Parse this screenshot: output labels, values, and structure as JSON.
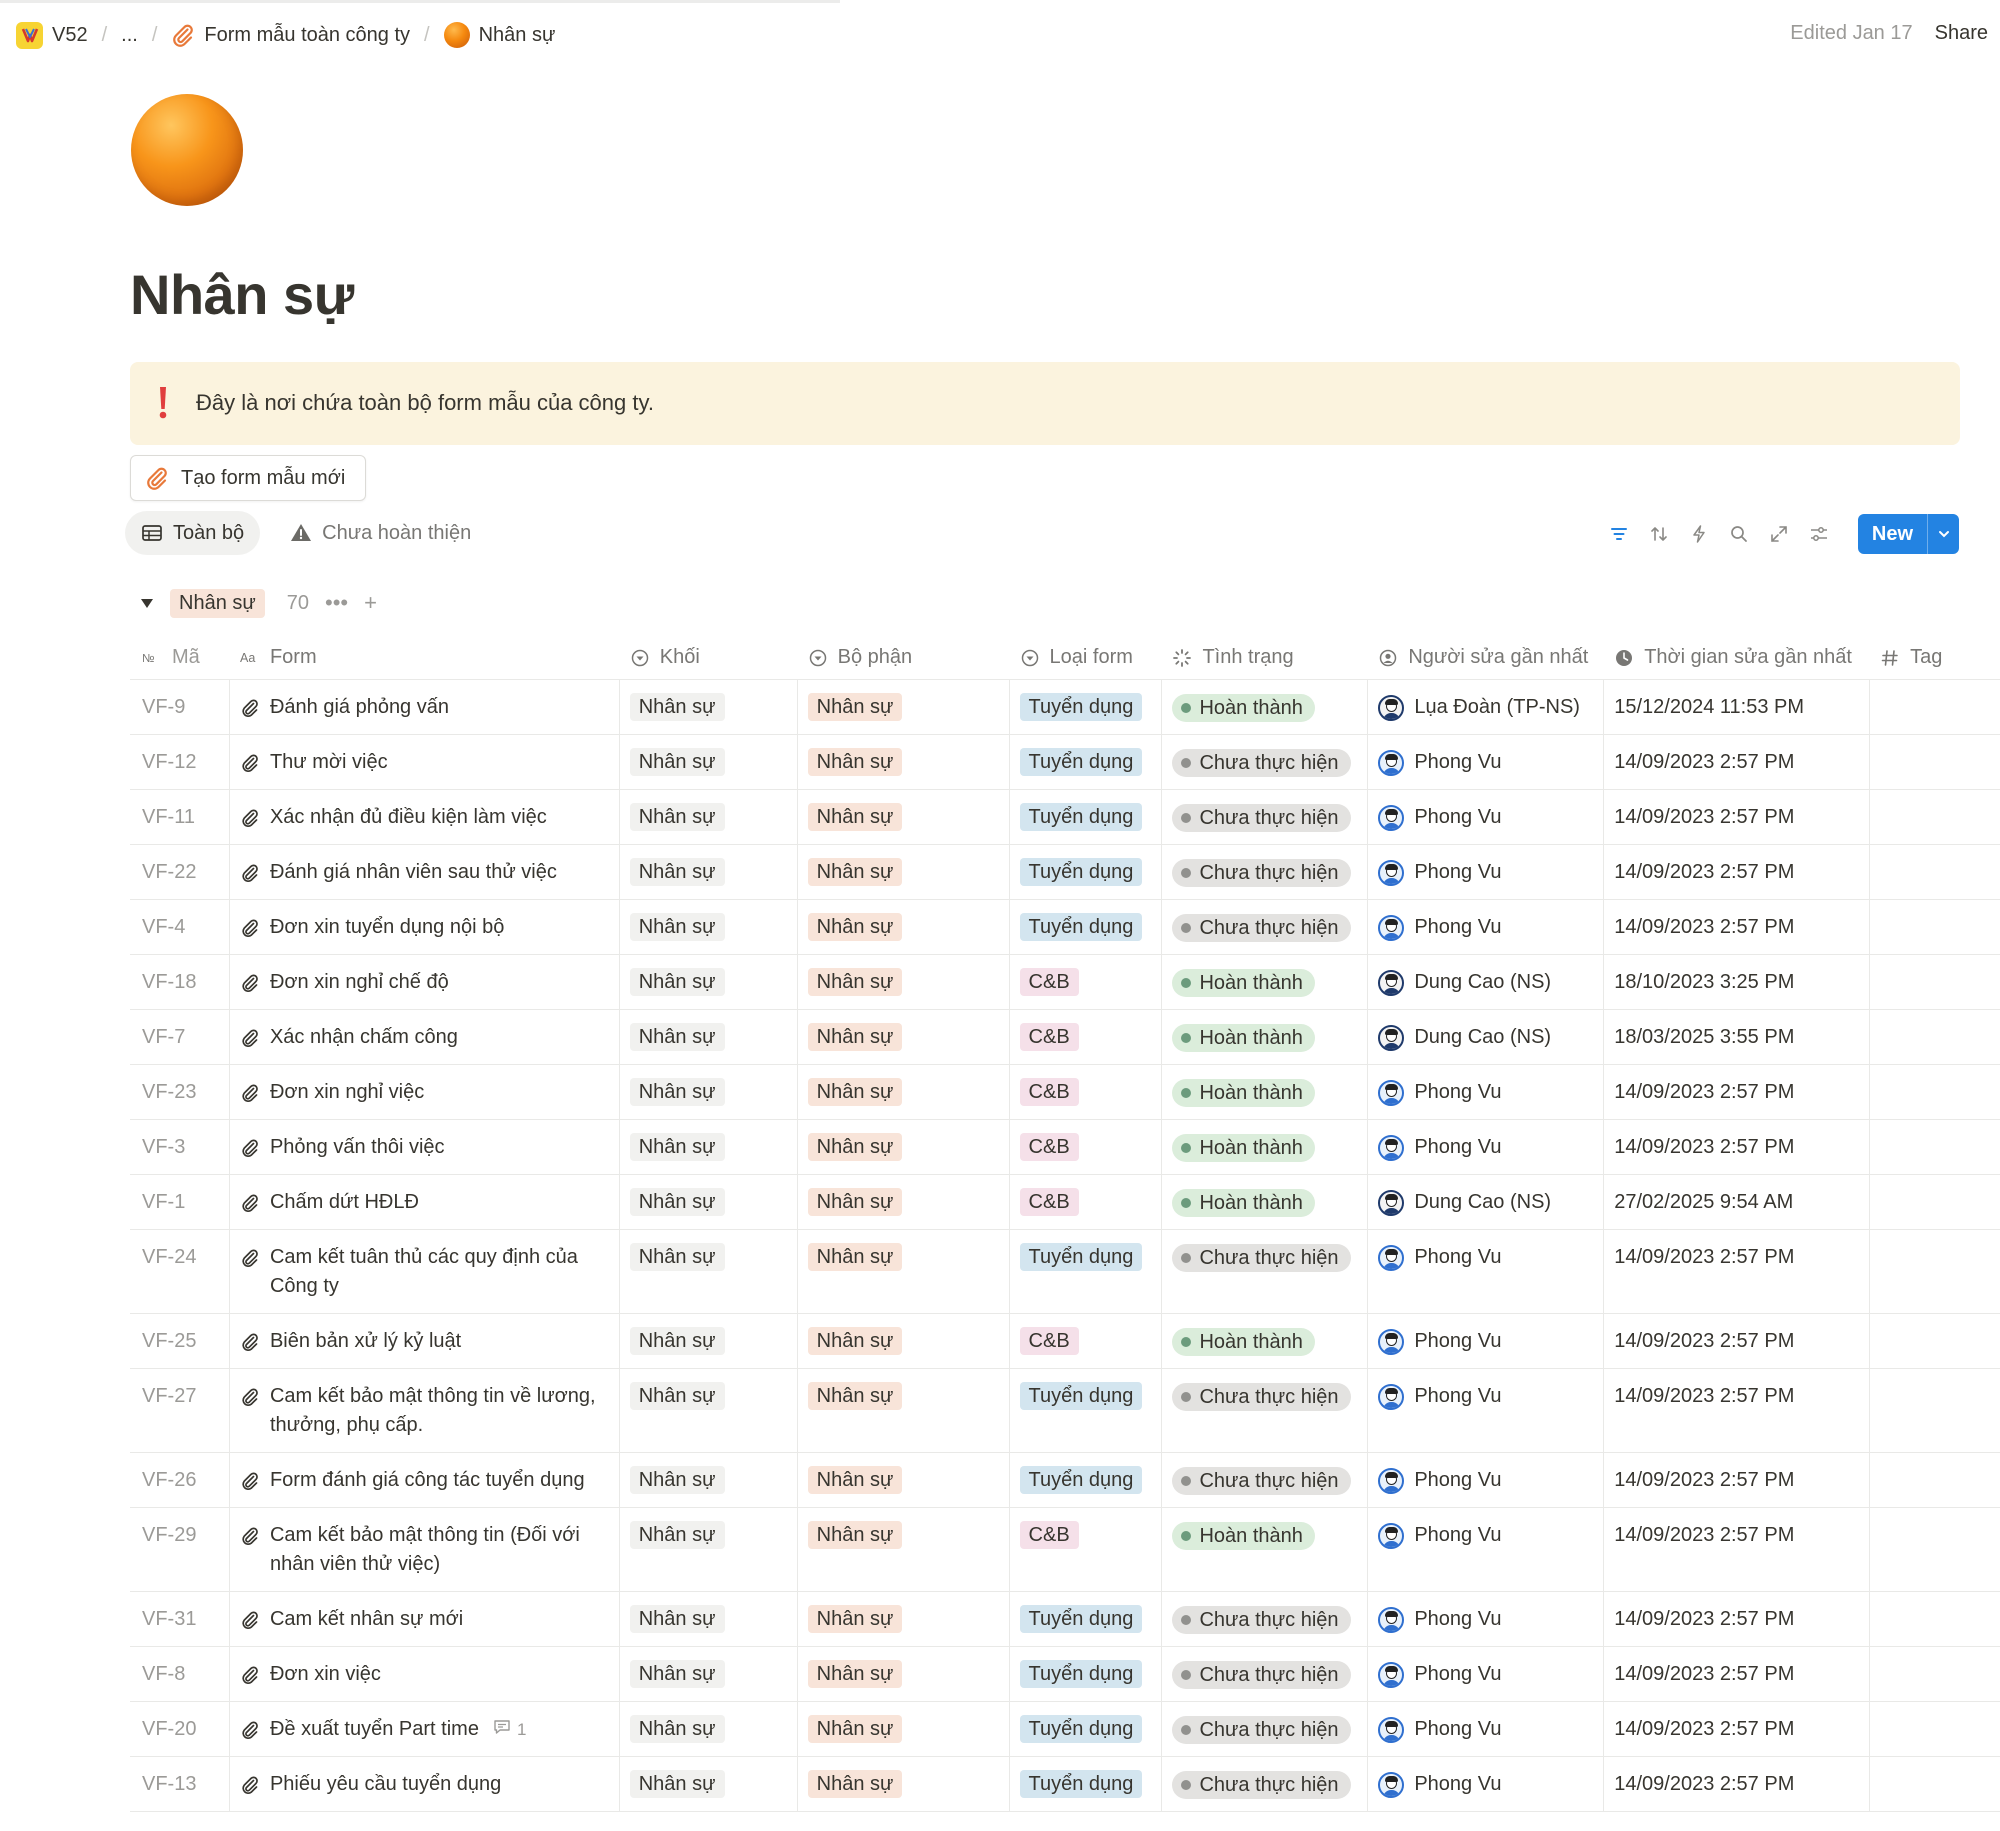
{
  "breadcrumb": {
    "workspace": "V52",
    "ellipsis": "...",
    "parent": "Form mẫu toàn công ty",
    "current": "Nhân sự"
  },
  "topbar": {
    "edited": "Edited Jan 17",
    "share": "Share"
  },
  "page": {
    "title": "Nhân sự",
    "icon": "orange-circle-emoji",
    "callout_icon": "exclamation-icon",
    "callout": "Đây là nơi chứa toàn bộ form mẫu của công ty.",
    "new_form_button": "Tạo form mẫu mới"
  },
  "views": [
    {
      "label": "Toàn bộ",
      "icon": "table-icon",
      "active": true
    },
    {
      "label": "Chưa hoàn thiện",
      "icon": "warning-icon",
      "active": false
    }
  ],
  "toolbar": {
    "new_label": "New",
    "tools": [
      "filter-icon",
      "sort-icon",
      "automation-icon",
      "search-icon",
      "expand-icon",
      "settings-icon"
    ]
  },
  "group": {
    "label": "Nhân sự",
    "count": "70",
    "more": "•••",
    "add": "+"
  },
  "columns": {
    "code": "Mã",
    "form": "Form",
    "khoi": "Khối",
    "bophan": "Bộ phận",
    "loaiform": "Loại form",
    "tinhtrang": "Tình trạng",
    "nguoisua": "Người sửa gần nhất",
    "thoigian": "Thời gian sửa gần nhất",
    "tag": "Tag"
  },
  "colors": {
    "accent": "#2383e2",
    "callout_bg": "#fbf3de",
    "tag_khoi": "#f1f1ef",
    "tag_bophan": "#f8e4d9",
    "tag_tuyendung": "#d3e5ef",
    "tag_cb": "#f5e0e9",
    "status_done": "#dbeddb",
    "status_todo": "#e3e2e0"
  },
  "rows": [
    {
      "code": "VF-9",
      "form": "Đánh giá phỏng vấn",
      "khoi": "Nhân sự",
      "bophan": "Nhân sự",
      "loaiform": "Tuyển dụng",
      "tinhtrang": "Hoàn thành",
      "nguoisua": "Lụa Đoàn (TP-NS)",
      "thoigian": "15/12/2024 11:53 PM",
      "tag": ""
    },
    {
      "code": "VF-12",
      "form": "Thư mời việc",
      "khoi": "Nhân sự",
      "bophan": "Nhân sự",
      "loaiform": "Tuyển dụng",
      "tinhtrang": "Chưa thực hiện",
      "nguoisua": "Phong Vu",
      "thoigian": "14/09/2023 2:57 PM",
      "tag": ""
    },
    {
      "code": "VF-11",
      "form": "Xác nhận đủ điều kiện làm việc",
      "khoi": "Nhân sự",
      "bophan": "Nhân sự",
      "loaiform": "Tuyển dụng",
      "tinhtrang": "Chưa thực hiện",
      "nguoisua": "Phong Vu",
      "thoigian": "14/09/2023 2:57 PM",
      "tag": ""
    },
    {
      "code": "VF-22",
      "form": "Đánh giá nhân viên sau thử việc",
      "khoi": "Nhân sự",
      "bophan": "Nhân sự",
      "loaiform": "Tuyển dụng",
      "tinhtrang": "Chưa thực hiện",
      "nguoisua": "Phong Vu",
      "thoigian": "14/09/2023 2:57 PM",
      "tag": ""
    },
    {
      "code": "VF-4",
      "form": "Đơn xin tuyển dụng nội bộ",
      "khoi": "Nhân sự",
      "bophan": "Nhân sự",
      "loaiform": "Tuyển dụng",
      "tinhtrang": "Chưa thực hiện",
      "nguoisua": "Phong Vu",
      "thoigian": "14/09/2023 2:57 PM",
      "tag": ""
    },
    {
      "code": "VF-18",
      "form": "Đơn xin nghỉ chế độ",
      "khoi": "Nhân sự",
      "bophan": "Nhân sự",
      "loaiform": "C&B",
      "tinhtrang": "Hoàn thành",
      "nguoisua": "Dung Cao (NS)",
      "thoigian": "18/10/2023 3:25 PM",
      "tag": ""
    },
    {
      "code": "VF-7",
      "form": "Xác nhận chấm công",
      "khoi": "Nhân sự",
      "bophan": "Nhân sự",
      "loaiform": "C&B",
      "tinhtrang": "Hoàn thành",
      "nguoisua": "Dung Cao (NS)",
      "thoigian": "18/03/2025 3:55 PM",
      "tag": ""
    },
    {
      "code": "VF-23",
      "form": "Đơn xin nghỉ việc",
      "khoi": "Nhân sự",
      "bophan": "Nhân sự",
      "loaiform": "C&B",
      "tinhtrang": "Hoàn thành",
      "nguoisua": "Phong Vu",
      "thoigian": "14/09/2023 2:57 PM",
      "tag": ""
    },
    {
      "code": "VF-3",
      "form": "Phỏng vấn thôi việc",
      "khoi": "Nhân sự",
      "bophan": "Nhân sự",
      "loaiform": "C&B",
      "tinhtrang": "Hoàn thành",
      "nguoisua": "Phong Vu",
      "thoigian": "14/09/2023 2:57 PM",
      "tag": ""
    },
    {
      "code": "VF-1",
      "form": "Chấm dứt HĐLĐ",
      "khoi": "Nhân sự",
      "bophan": "Nhân sự",
      "loaiform": "C&B",
      "tinhtrang": "Hoàn thành",
      "nguoisua": "Dung Cao (NS)",
      "thoigian": "27/02/2025 9:54 AM",
      "tag": ""
    },
    {
      "code": "VF-24",
      "form": "Cam kết tuân thủ các quy định của Công ty",
      "khoi": "Nhân sự",
      "bophan": "Nhân sự",
      "loaiform": "Tuyển dụng",
      "tinhtrang": "Chưa thực hiện",
      "nguoisua": "Phong Vu",
      "thoigian": "14/09/2023 2:57 PM",
      "tag": ""
    },
    {
      "code": "VF-25",
      "form": "Biên bản xử lý kỷ luật",
      "khoi": "Nhân sự",
      "bophan": "Nhân sự",
      "loaiform": "C&B",
      "tinhtrang": "Hoàn thành",
      "nguoisua": "Phong Vu",
      "thoigian": "14/09/2023 2:57 PM",
      "tag": ""
    },
    {
      "code": "VF-27",
      "form": "Cam kết bảo mật thông tin về lương, thưởng, phụ cấp.",
      "khoi": "Nhân sự",
      "bophan": "Nhân sự",
      "loaiform": "Tuyển dụng",
      "tinhtrang": "Chưa thực hiện",
      "nguoisua": "Phong Vu",
      "thoigian": "14/09/2023 2:57 PM",
      "tag": ""
    },
    {
      "code": "VF-26",
      "form": "Form đánh giá công tác tuyển dụng",
      "khoi": "Nhân sự",
      "bophan": "Nhân sự",
      "loaiform": "Tuyển dụng",
      "tinhtrang": "Chưa thực hiện",
      "nguoisua": "Phong Vu",
      "thoigian": "14/09/2023 2:57 PM",
      "tag": ""
    },
    {
      "code": "VF-29",
      "form": "Cam kết bảo mật thông tin (Đối với nhân viên thử việc)",
      "khoi": "Nhân sự",
      "bophan": "Nhân sự",
      "loaiform": "C&B",
      "tinhtrang": "Hoàn thành",
      "nguoisua": "Phong Vu",
      "thoigian": "14/09/2023 2:57 PM",
      "tag": ""
    },
    {
      "code": "VF-31",
      "form": "Cam kết nhân sự mới",
      "khoi": "Nhân sự",
      "bophan": "Nhân sự",
      "loaiform": "Tuyển dụng",
      "tinhtrang": "Chưa thực hiện",
      "nguoisua": "Phong Vu",
      "thoigian": "14/09/2023 2:57 PM",
      "tag": ""
    },
    {
      "code": "VF-8",
      "form": "Đơn xin việc",
      "khoi": "Nhân sự",
      "bophan": "Nhân sự",
      "loaiform": "Tuyển dụng",
      "tinhtrang": "Chưa thực hiện",
      "nguoisua": "Phong Vu",
      "thoigian": "14/09/2023 2:57 PM",
      "tag": ""
    },
    {
      "code": "VF-20",
      "form": "Đề xuất tuyển Part time",
      "comments": "1",
      "khoi": "Nhân sự",
      "bophan": "Nhân sự",
      "loaiform": "Tuyển dụng",
      "tinhtrang": "Chưa thực hiện",
      "nguoisua": "Phong Vu",
      "thoigian": "14/09/2023 2:57 PM",
      "tag": ""
    },
    {
      "code": "VF-13",
      "form": "Phiếu yêu cầu tuyển dụng",
      "khoi": "Nhân sự",
      "bophan": "Nhân sự",
      "loaiform": "Tuyển dụng",
      "tinhtrang": "Chưa thực hiện",
      "nguoisua": "Phong Vu",
      "thoigian": "14/09/2023 2:57 PM",
      "tag": ""
    }
  ]
}
